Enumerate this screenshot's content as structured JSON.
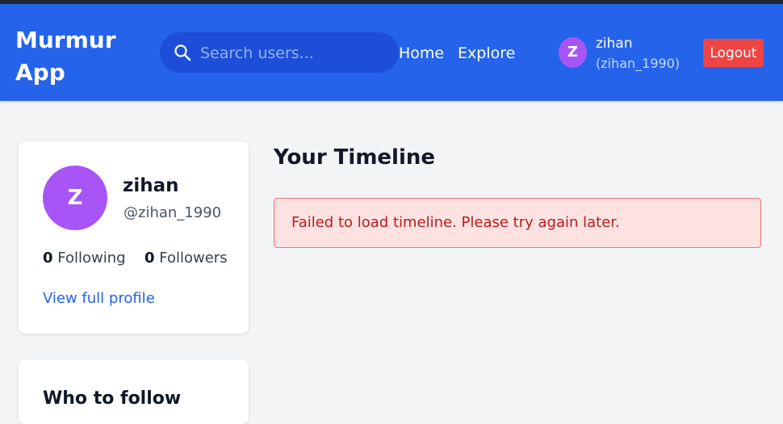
{
  "header": {
    "brand": "Murmur App",
    "search": {
      "placeholder": "Search users...",
      "value": ""
    },
    "nav": {
      "home": "Home",
      "explore": "Explore"
    },
    "user": {
      "avatar_letter": "Z",
      "name": "zihan",
      "handle": "(zihan_1990)"
    },
    "logout_label": "Logout"
  },
  "profile": {
    "avatar_letter": "Z",
    "name": "zihan",
    "handle": "@zihan_1990",
    "following_count": "0",
    "following_label": "Following",
    "followers_count": "0",
    "followers_label": "Followers",
    "view_profile_label": "View full profile"
  },
  "who_to_follow": {
    "title": "Who to follow"
  },
  "timeline": {
    "title": "Your Timeline",
    "error": "Failed to load timeline. Please try again later."
  },
  "colors": {
    "navbar": "#2563eb",
    "avatar": "#a855f7",
    "logout": "#ef4444",
    "error_bg": "#fee2e2",
    "error_text": "#b91c1c",
    "link": "#2563eb"
  }
}
